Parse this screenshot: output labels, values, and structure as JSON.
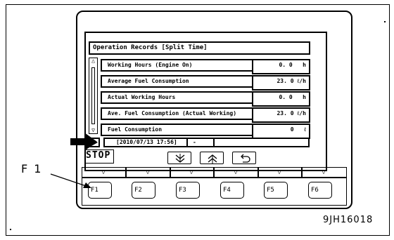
{
  "screen": {
    "header": "Operation Records  [Split Time]",
    "rows": [
      {
        "label": "Working Hours (Engine On)",
        "value": "0. 0",
        "unit": "h"
      },
      {
        "label": "Average Fuel Consumption",
        "value": "23. 0",
        "unit": "ℓ/h"
      },
      {
        "label": "Actual Working Hours",
        "value": "0. 0",
        "unit": "h"
      },
      {
        "label": "Ave. Fuel Consumption (Actual Working)",
        "value": "23. 0",
        "unit": "ℓ/h"
      },
      {
        "label": "Fuel Consumption",
        "value": "0",
        "unit": "ℓ"
      }
    ],
    "start_time": "[2010/07/13  17:56]",
    "end_separator": "-",
    "stop_label": "STOP"
  },
  "function_keys": [
    "F1",
    "F2",
    "F3",
    "F4",
    "F5",
    "F6"
  ],
  "callout_label": "F 1",
  "figure_code": "9JH16018"
}
